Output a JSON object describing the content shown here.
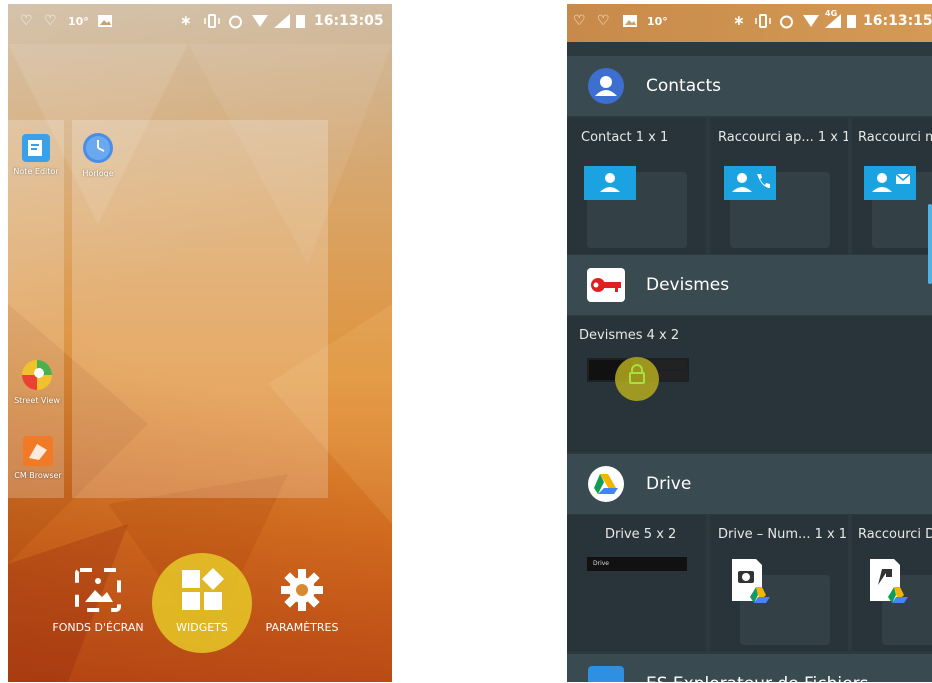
{
  "left_phone": {
    "status": {
      "left_icons": [
        "♡",
        "♡"
      ],
      "temperature": "10°",
      "time": "16:13:05"
    },
    "apps": [
      {
        "label": "Note Editor"
      },
      {
        "label": "Horloge"
      },
      {
        "label": "Street View"
      },
      {
        "label": "CM Browser"
      }
    ],
    "bottom_bar": {
      "wallpapers": "FONDS D'ÉCRAN",
      "widgets": "WIDGETS",
      "settings": "PARAMÈTRES"
    }
  },
  "right_phone": {
    "status": {
      "temperature": "10°",
      "time": "16:13:15",
      "network": "4G"
    },
    "sections": [
      {
        "app_name": "Contacts",
        "widgets": [
          {
            "title": "Contact 1 x 1"
          },
          {
            "title": "Raccourci ap...  1 x 1"
          },
          {
            "title": "Raccourci m"
          }
        ]
      },
      {
        "app_name": "Devismes",
        "widgets": [
          {
            "title": "Devismes 4 x 2"
          }
        ]
      },
      {
        "app_name": "Drive",
        "widgets": [
          {
            "title": "Drive 5 x 2"
          },
          {
            "title": "Drive – Num...  1 x 1"
          },
          {
            "title": "Raccourci Dr"
          }
        ]
      },
      {
        "app_name": "ES Explorateur de Fichiers"
      }
    ],
    "drive_preview_label": "Drive"
  },
  "colors": {
    "accent_yellow": "#e6c828",
    "widget_bg": "#283439",
    "header_bg": "#3a4a51",
    "contact_blue": "#1aa3e0"
  }
}
